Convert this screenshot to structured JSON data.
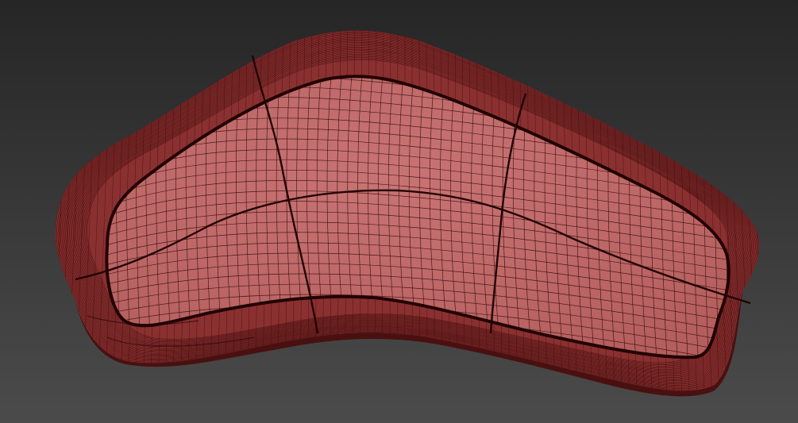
{
  "scene": {
    "colors": {
      "background_top": "#262626",
      "background_bottom": "#4b4b4b",
      "mesh_fill": "#b45e5e",
      "mesh_fill_light": "#c97474",
      "mesh_rim": "#8a3030",
      "mesh_rim_dark": "#4a1010",
      "wire": "#3a0a0a",
      "seam": "#220303"
    },
    "object": "subdivided-cushion-mesh",
    "rendering": "wireframe-on-shaded"
  }
}
